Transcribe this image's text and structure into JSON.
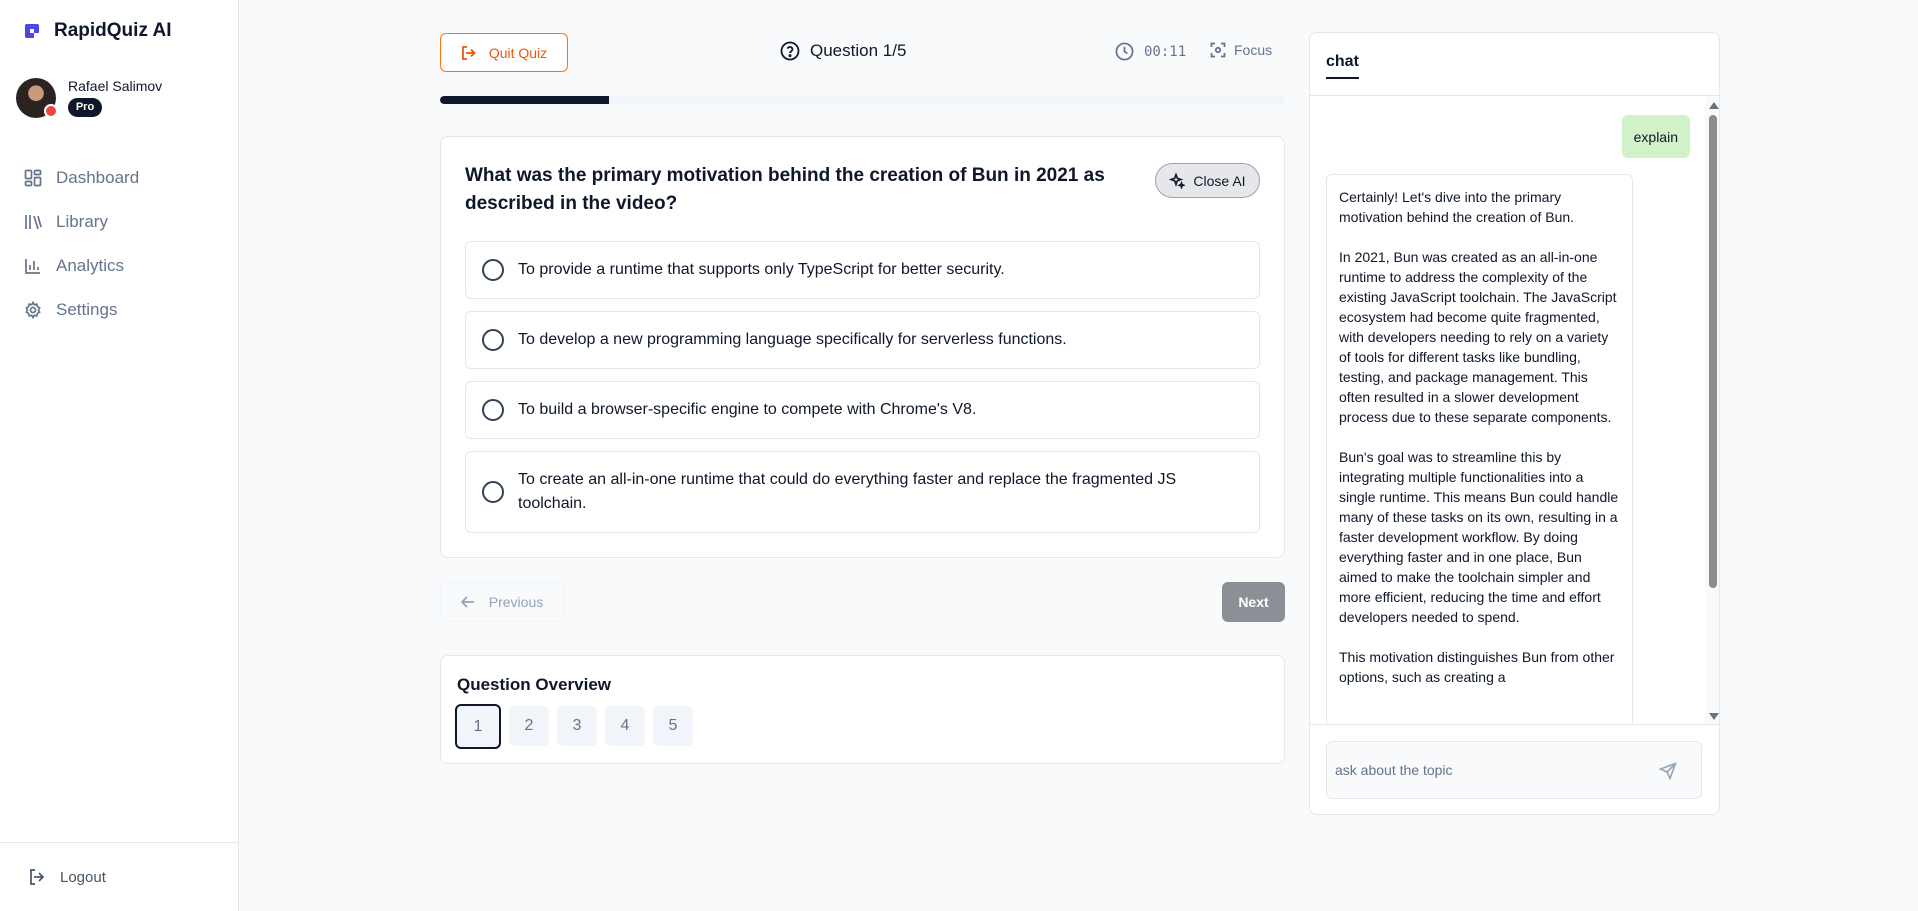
{
  "app": {
    "name": "RapidQuiz AI",
    "brand_color": "#4f46e5"
  },
  "user": {
    "name": "Rafael Salimov",
    "badge": "Pro"
  },
  "sidebar": {
    "items": [
      {
        "label": "Dashboard",
        "icon": "dashboard-icon"
      },
      {
        "label": "Library",
        "icon": "library-icon"
      },
      {
        "label": "Analytics",
        "icon": "analytics-icon"
      },
      {
        "label": "Settings",
        "icon": "settings-icon"
      }
    ],
    "logout_label": "Logout"
  },
  "topbar": {
    "quit_label": "Quit Quiz",
    "question_counter": "Question 1/5",
    "timer": "00:11",
    "focus_label": "Focus",
    "progress_percent": 20
  },
  "question": {
    "text": "What was the primary motivation behind the creation of Bun in 2021 as described in the video?",
    "close_ai_label": "Close AI",
    "options": [
      "To provide a runtime that supports only TypeScript for better security.",
      "To develop a new programming language specifically for serverless functions.",
      "To build a browser-specific engine to compete with Chrome's V8.",
      "To create an all-in-one runtime that could do everything faster and replace the fragmented JS toolchain."
    ]
  },
  "navigation": {
    "previous_label": "Previous",
    "next_label": "Next"
  },
  "overview": {
    "title": "Question Overview",
    "numbers": [
      "1",
      "2",
      "3",
      "4",
      "5"
    ],
    "current": 1
  },
  "chat": {
    "tab_label": "chat",
    "user_message": "explain",
    "ai_paragraphs": [
      "Certainly! Let's dive into the primary motivation behind the creation of Bun.",
      "In 2021, Bun was created as an all-in-one runtime to address the complexity of the existing JavaScript toolchain. The JavaScript ecosystem had become quite fragmented, with developers needing to rely on a variety of tools for different tasks like bundling, testing, and package management. This often resulted in a slower development process due to these separate components.",
      "Bun's goal was to streamline this by integrating multiple functionalities into a single runtime. This means Bun could handle many of these tasks on its own, resulting in a faster development workflow. By doing everything faster and in one place, Bun aimed to make the toolchain simpler and more efficient, reducing the time and effort developers needed to spend.",
      "This motivation distinguishes Bun from other options, such as creating a"
    ],
    "input_placeholder": "ask about the topic"
  }
}
